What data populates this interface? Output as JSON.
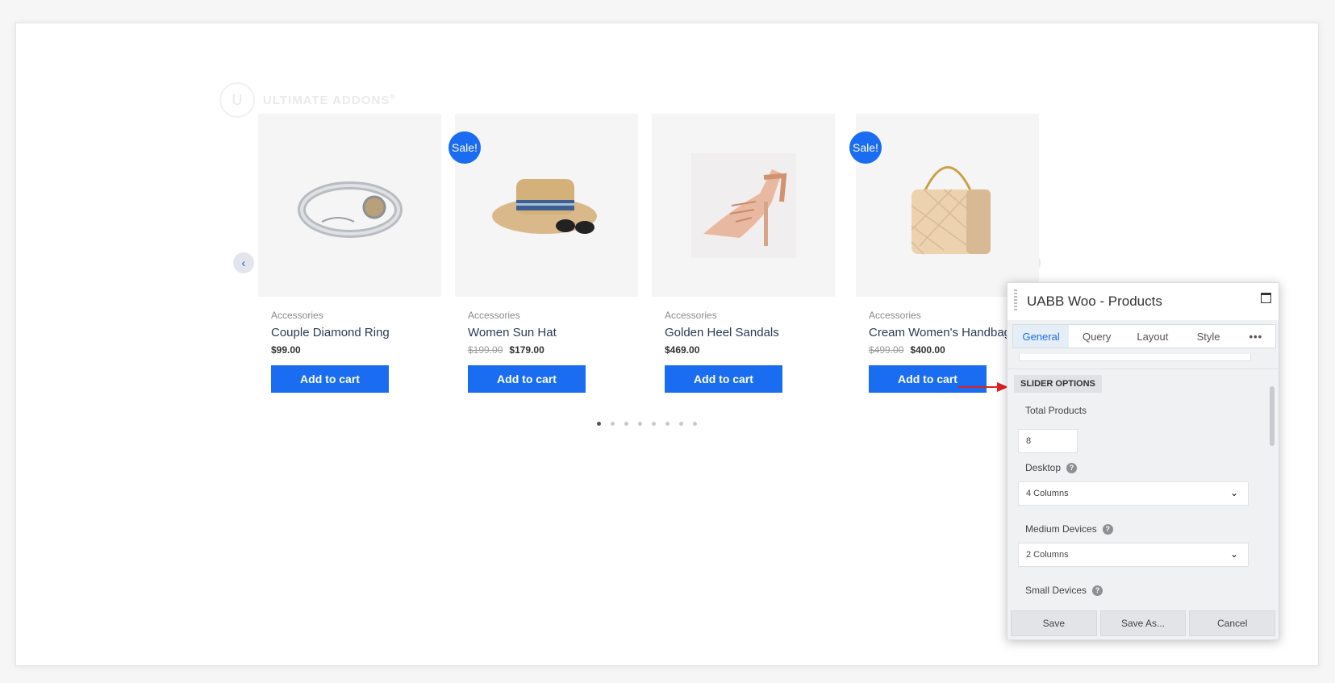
{
  "brand": {
    "name": "ULTIMATE ADDONS",
    "mark": "U",
    "sup": "®"
  },
  "slider": {
    "prev_icon": "chevron-left-icon",
    "next_icon": "chevron-right-icon",
    "page_count": 8,
    "active_page": 1
  },
  "products": [
    {
      "category": "Accessories",
      "title": "Couple Diamond Ring",
      "price": "$99.00",
      "old_price": "",
      "sale": false,
      "image": "bracelet",
      "button": "Add to cart"
    },
    {
      "category": "Accessories",
      "title": "Women Sun Hat",
      "price": "$179.00",
      "old_price": "$199.00",
      "sale": true,
      "sale_label": "Sale!",
      "image": "sun-hat",
      "button": "Add to cart"
    },
    {
      "category": "Accessories",
      "title": "Golden Heel Sandals",
      "price": "$469.00",
      "old_price": "",
      "sale": false,
      "image": "heel-sandal",
      "button": "Add to cart"
    },
    {
      "category": "Accessories",
      "title": "Cream Women's Handbag",
      "price": "$400.00",
      "old_price": "$499.00",
      "sale": true,
      "sale_label": "Sale!",
      "image": "handbag",
      "button": "Add to cart"
    }
  ],
  "panel": {
    "title": "UABB Woo - Products",
    "tabs": [
      "General",
      "Query",
      "Layout",
      "Style",
      "•••"
    ],
    "active_tab": "General",
    "section": "SLIDER OPTIONS",
    "total_products": {
      "label": "Total Products",
      "value": "8"
    },
    "desktop": {
      "label": "Desktop",
      "value": "4 Columns"
    },
    "medium": {
      "label": "Medium Devices",
      "value": "2 Columns"
    },
    "small": {
      "label": "Small Devices"
    },
    "help_glyph": "?",
    "chevron": "⌄",
    "buttons": {
      "save": "Save",
      "save_as": "Save As...",
      "cancel": "Cancel"
    }
  },
  "colors": {
    "accent": "#1a6cf0",
    "annotation_arrow": "#e02020"
  }
}
